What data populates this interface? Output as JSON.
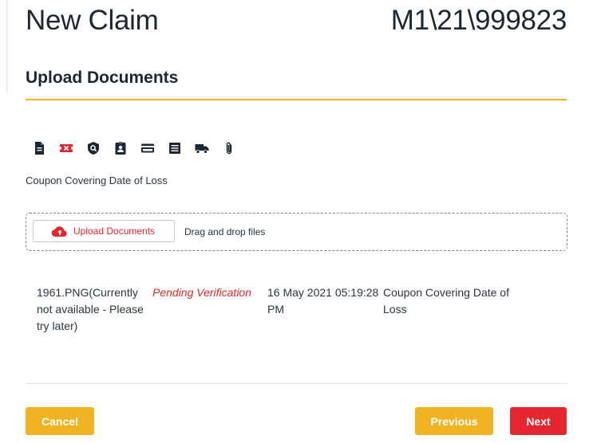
{
  "header": {
    "title": "New Claim",
    "claim_number": "M1\\21\\999823"
  },
  "section": {
    "title": "Upload Documents"
  },
  "document_types": {
    "icons": [
      {
        "name": "document-icon",
        "color": "#1c2733"
      },
      {
        "name": "ticket-icon",
        "color": "#e4262e"
      },
      {
        "name": "shield-search-icon",
        "color": "#1c2733"
      },
      {
        "name": "id-badge-icon",
        "color": "#1c2733"
      },
      {
        "name": "credit-card-icon",
        "color": "#1c2733"
      },
      {
        "name": "list-icon",
        "color": "#1c2733"
      },
      {
        "name": "truck-icon",
        "color": "#1c2733"
      },
      {
        "name": "paperclip-icon",
        "color": "#1c2733"
      }
    ],
    "selected_label": "Coupon Covering Date of Loss"
  },
  "dropzone": {
    "upload_button_label": "Upload Documents",
    "drag_text": "Drag and drop files"
  },
  "files": [
    {
      "name": "1961.PNG(Currently not available - Please try later)",
      "status": "Pending Verification",
      "uploaded_at": "16 May 2021 05:19:28 PM",
      "document_type": "Coupon Covering Date of Loss"
    }
  ],
  "footer": {
    "cancel_label": "Cancel",
    "previous_label": "Previous",
    "next_label": "Next"
  },
  "colors": {
    "accent_yellow": "#f0b323",
    "accent_red": "#e4262e",
    "text_dark": "#1c2733"
  }
}
